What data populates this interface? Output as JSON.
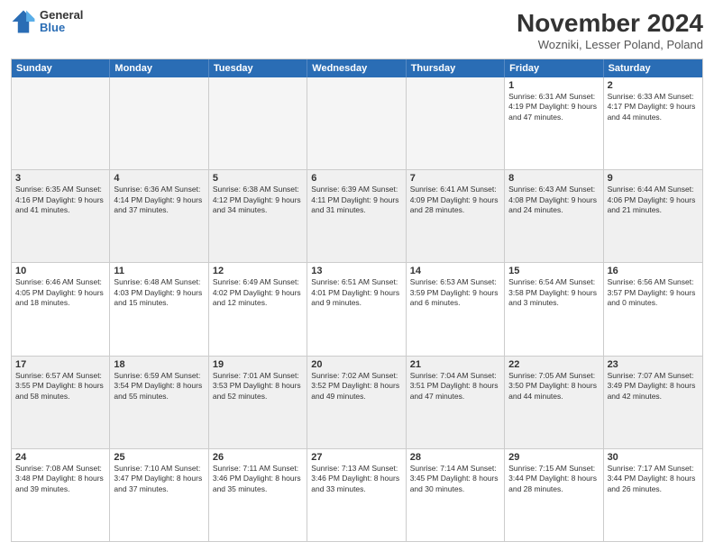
{
  "logo": {
    "general": "General",
    "blue": "Blue"
  },
  "title": "November 2024",
  "location": "Wozniki, Lesser Poland, Poland",
  "days": [
    "Sunday",
    "Monday",
    "Tuesday",
    "Wednesday",
    "Thursday",
    "Friday",
    "Saturday"
  ],
  "weeks": [
    [
      {
        "day": "",
        "info": "",
        "empty": true
      },
      {
        "day": "",
        "info": "",
        "empty": true
      },
      {
        "day": "",
        "info": "",
        "empty": true
      },
      {
        "day": "",
        "info": "",
        "empty": true
      },
      {
        "day": "",
        "info": "",
        "empty": true
      },
      {
        "day": "1",
        "info": "Sunrise: 6:31 AM\nSunset: 4:19 PM\nDaylight: 9 hours\nand 47 minutes.",
        "empty": false
      },
      {
        "day": "2",
        "info": "Sunrise: 6:33 AM\nSunset: 4:17 PM\nDaylight: 9 hours\nand 44 minutes.",
        "empty": false
      }
    ],
    [
      {
        "day": "3",
        "info": "Sunrise: 6:35 AM\nSunset: 4:16 PM\nDaylight: 9 hours\nand 41 minutes.",
        "empty": false,
        "shaded": true
      },
      {
        "day": "4",
        "info": "Sunrise: 6:36 AM\nSunset: 4:14 PM\nDaylight: 9 hours\nand 37 minutes.",
        "empty": false,
        "shaded": true
      },
      {
        "day": "5",
        "info": "Sunrise: 6:38 AM\nSunset: 4:12 PM\nDaylight: 9 hours\nand 34 minutes.",
        "empty": false,
        "shaded": true
      },
      {
        "day": "6",
        "info": "Sunrise: 6:39 AM\nSunset: 4:11 PM\nDaylight: 9 hours\nand 31 minutes.",
        "empty": false,
        "shaded": true
      },
      {
        "day": "7",
        "info": "Sunrise: 6:41 AM\nSunset: 4:09 PM\nDaylight: 9 hours\nand 28 minutes.",
        "empty": false,
        "shaded": true
      },
      {
        "day": "8",
        "info": "Sunrise: 6:43 AM\nSunset: 4:08 PM\nDaylight: 9 hours\nand 24 minutes.",
        "empty": false,
        "shaded": true
      },
      {
        "day": "9",
        "info": "Sunrise: 6:44 AM\nSunset: 4:06 PM\nDaylight: 9 hours\nand 21 minutes.",
        "empty": false,
        "shaded": true
      }
    ],
    [
      {
        "day": "10",
        "info": "Sunrise: 6:46 AM\nSunset: 4:05 PM\nDaylight: 9 hours\nand 18 minutes.",
        "empty": false
      },
      {
        "day": "11",
        "info": "Sunrise: 6:48 AM\nSunset: 4:03 PM\nDaylight: 9 hours\nand 15 minutes.",
        "empty": false
      },
      {
        "day": "12",
        "info": "Sunrise: 6:49 AM\nSunset: 4:02 PM\nDaylight: 9 hours\nand 12 minutes.",
        "empty": false
      },
      {
        "day": "13",
        "info": "Sunrise: 6:51 AM\nSunset: 4:01 PM\nDaylight: 9 hours\nand 9 minutes.",
        "empty": false
      },
      {
        "day": "14",
        "info": "Sunrise: 6:53 AM\nSunset: 3:59 PM\nDaylight: 9 hours\nand 6 minutes.",
        "empty": false
      },
      {
        "day": "15",
        "info": "Sunrise: 6:54 AM\nSunset: 3:58 PM\nDaylight: 9 hours\nand 3 minutes.",
        "empty": false
      },
      {
        "day": "16",
        "info": "Sunrise: 6:56 AM\nSunset: 3:57 PM\nDaylight: 9 hours\nand 0 minutes.",
        "empty": false
      }
    ],
    [
      {
        "day": "17",
        "info": "Sunrise: 6:57 AM\nSunset: 3:55 PM\nDaylight: 8 hours\nand 58 minutes.",
        "empty": false,
        "shaded": true
      },
      {
        "day": "18",
        "info": "Sunrise: 6:59 AM\nSunset: 3:54 PM\nDaylight: 8 hours\nand 55 minutes.",
        "empty": false,
        "shaded": true
      },
      {
        "day": "19",
        "info": "Sunrise: 7:01 AM\nSunset: 3:53 PM\nDaylight: 8 hours\nand 52 minutes.",
        "empty": false,
        "shaded": true
      },
      {
        "day": "20",
        "info": "Sunrise: 7:02 AM\nSunset: 3:52 PM\nDaylight: 8 hours\nand 49 minutes.",
        "empty": false,
        "shaded": true
      },
      {
        "day": "21",
        "info": "Sunrise: 7:04 AM\nSunset: 3:51 PM\nDaylight: 8 hours\nand 47 minutes.",
        "empty": false,
        "shaded": true
      },
      {
        "day": "22",
        "info": "Sunrise: 7:05 AM\nSunset: 3:50 PM\nDaylight: 8 hours\nand 44 minutes.",
        "empty": false,
        "shaded": true
      },
      {
        "day": "23",
        "info": "Sunrise: 7:07 AM\nSunset: 3:49 PM\nDaylight: 8 hours\nand 42 minutes.",
        "empty": false,
        "shaded": true
      }
    ],
    [
      {
        "day": "24",
        "info": "Sunrise: 7:08 AM\nSunset: 3:48 PM\nDaylight: 8 hours\nand 39 minutes.",
        "empty": false
      },
      {
        "day": "25",
        "info": "Sunrise: 7:10 AM\nSunset: 3:47 PM\nDaylight: 8 hours\nand 37 minutes.",
        "empty": false
      },
      {
        "day": "26",
        "info": "Sunrise: 7:11 AM\nSunset: 3:46 PM\nDaylight: 8 hours\nand 35 minutes.",
        "empty": false
      },
      {
        "day": "27",
        "info": "Sunrise: 7:13 AM\nSunset: 3:46 PM\nDaylight: 8 hours\nand 33 minutes.",
        "empty": false
      },
      {
        "day": "28",
        "info": "Sunrise: 7:14 AM\nSunset: 3:45 PM\nDaylight: 8 hours\nand 30 minutes.",
        "empty": false
      },
      {
        "day": "29",
        "info": "Sunrise: 7:15 AM\nSunset: 3:44 PM\nDaylight: 8 hours\nand 28 minutes.",
        "empty": false
      },
      {
        "day": "30",
        "info": "Sunrise: 7:17 AM\nSunset: 3:44 PM\nDaylight: 8 hours\nand 26 minutes.",
        "empty": false
      }
    ]
  ]
}
